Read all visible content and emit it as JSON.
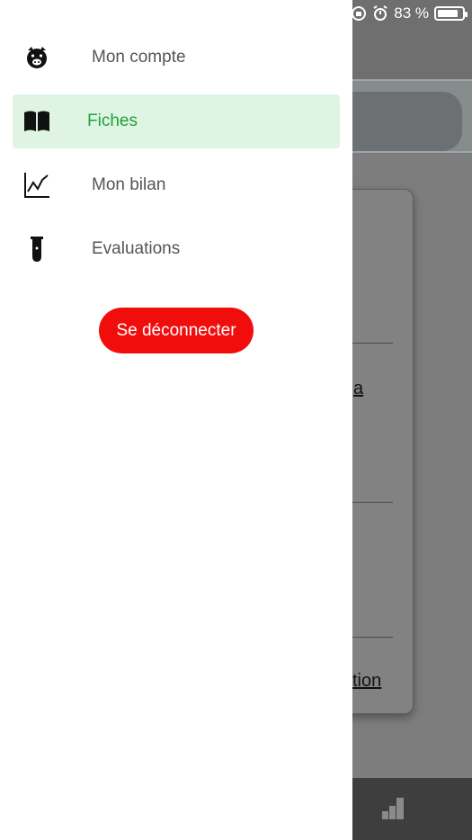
{
  "status_bar": {
    "battery_percent": "83 %",
    "battery_level": 0.83
  },
  "drawer": {
    "items": [
      {
        "label": "Mon compte",
        "icon": "pig-icon",
        "active": false
      },
      {
        "label": "Fiches",
        "icon": "book-icon",
        "active": true
      },
      {
        "label": "Mon bilan",
        "icon": "chart-icon",
        "active": false
      },
      {
        "label": "Evaluations",
        "icon": "test-tube-icon",
        "active": false
      }
    ],
    "logout_label": "Se déconnecter"
  },
  "background": {
    "link_1": "a",
    "link_2": "tion"
  },
  "colors": {
    "active_text": "#1ea33b",
    "active_bg": "#dff4e2",
    "logout_bg": "#f20d0d"
  }
}
